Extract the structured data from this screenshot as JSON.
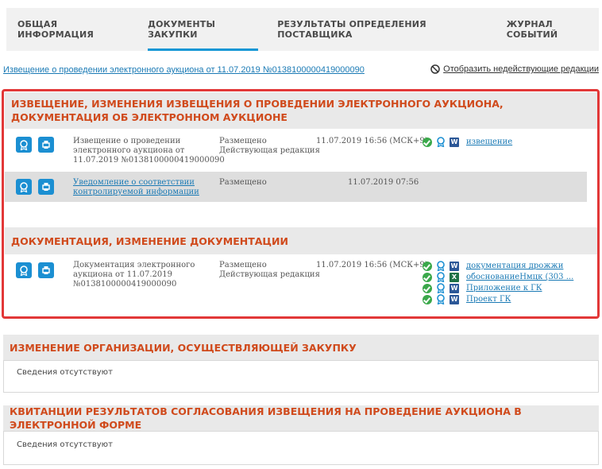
{
  "tabs": [
    {
      "label": "ОБЩАЯ ИНФОРМАЦИЯ"
    },
    {
      "label": "ДОКУМЕНТЫ ЗАКУПКИ"
    },
    {
      "label": "РЕЗУЛЬТАТЫ ОПРЕДЕЛЕНИЯ ПОСТАВЩИКА"
    },
    {
      "label": "ЖУРНАЛ СОБЫТИЙ"
    }
  ],
  "active_tab": "ДОКУМЕНТЫ ЗАКУПКИ",
  "top_link": "Извещение о проведении электронного аукциона от 11.07.2019 №0138100000419000090",
  "toggle_label": "Отобразить недействующие редакции",
  "sections": {
    "notice": {
      "title": "ИЗВЕЩЕНИЕ, ИЗМЕНЕНИЯ ИЗВЕЩЕНИЯ О ПРОВЕДЕНИИ ЭЛЕКТРОННОГО АУКЦИОНА, ДОКУМЕНТАЦИЯ ОБ ЭЛЕКТРОННОМ АУКЦИОНЕ",
      "rows": [
        {
          "name_lines": [
            "Извещение о проведении",
            "электронного аукциона от",
            "11.07.2019 №0138100000419000090"
          ],
          "status_lines": [
            "Размещено",
            "Действующая редакция"
          ],
          "date": "11.07.2019 16:56 (МСК+9)",
          "files": [
            {
              "type": "w",
              "name": "извещение"
            }
          ]
        },
        {
          "name_lines": [
            "Уведомление о соответствии",
            "контролируемой информации"
          ],
          "status_lines": [
            "Размещено"
          ],
          "date": "11.07.2019 07:56",
          "files": []
        }
      ]
    },
    "docs": {
      "title": "ДОКУМЕНТАЦИЯ, ИЗМЕНЕНИЕ ДОКУМЕНТАЦИИ",
      "rows": [
        {
          "name_lines": [
            "Документация электронного",
            "аукциона от 11.07.2019",
            "№0138100000419000090"
          ],
          "status_lines": [
            "Размещено",
            "Действующая редакция"
          ],
          "date": "11.07.2019 16:56 (МСК+9)",
          "files": [
            {
              "type": "w",
              "name": "документация дрожжи"
            },
            {
              "type": "x",
              "name": "обоснованиеНмцк (303 ..."
            },
            {
              "type": "w",
              "name": "Приложение к ГК"
            },
            {
              "type": "w",
              "name": "Проект ГК"
            }
          ]
        }
      ]
    },
    "org_change": {
      "title": "ИЗМЕНЕНИЕ ОРГАНИЗАЦИИ, ОСУЩЕСТВЛЯЮЩЕЙ ЗАКУПКУ",
      "empty": "Сведения отсутствуют"
    },
    "receipts": {
      "title": "КВИТАНЦИИ РЕЗУЛЬТАТОВ СОГЛАСОВАНИЯ ИЗВЕЩЕНИЯ НА ПРОВЕДЕНИЕ АУКЦИОНА В ЭЛЕКТРОННОЙ ФОРМЕ",
      "empty": "Сведения отсутствуют"
    }
  },
  "colors": {
    "accent": "#1597d5",
    "section_title": "#d04a1c",
    "highlight_border": "#e23838",
    "link": "#1a7ab5"
  }
}
